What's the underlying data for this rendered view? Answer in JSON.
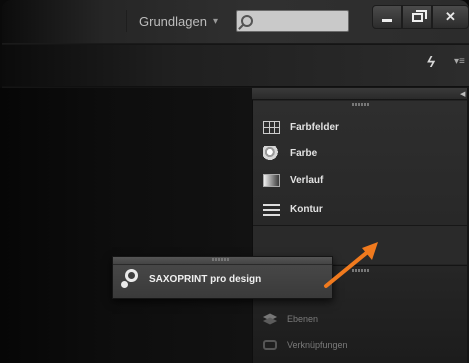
{
  "app_bar": {
    "workspace_label": "Grundlagen",
    "search": {
      "value": "",
      "placeholder": ""
    }
  },
  "window_controls": [
    "minimize-icon",
    "restore-icon",
    "close-icon"
  ],
  "control_bar": {
    "icons": [
      "lightning-bolt-icon",
      "panel-menu-icon"
    ]
  },
  "panel_group_1": {
    "items": [
      {
        "label": "Farbfelder",
        "icon": "swatches-icon"
      },
      {
        "label": "Farbe",
        "icon": "color-palette-icon"
      },
      {
        "label": "Verlauf",
        "icon": "gradient-icon"
      },
      {
        "label": "Kontur",
        "icon": "stroke-icon"
      }
    ]
  },
  "panel_group_2": {
    "items": [
      {
        "label": "Ebenen",
        "icon": "layers-icon"
      },
      {
        "label": "Verknüpfungen",
        "icon": "links-icon"
      }
    ]
  },
  "floating_panel": {
    "label": "SAXOPRINT pro design",
    "icon": "magnifier-icon"
  },
  "annotation": {
    "arrow_color": "#f07a1e"
  },
  "colors": {
    "ui_dark": "#232323",
    "panel_text": "#e2e2e2",
    "accent_arrow": "#f07a1e"
  }
}
